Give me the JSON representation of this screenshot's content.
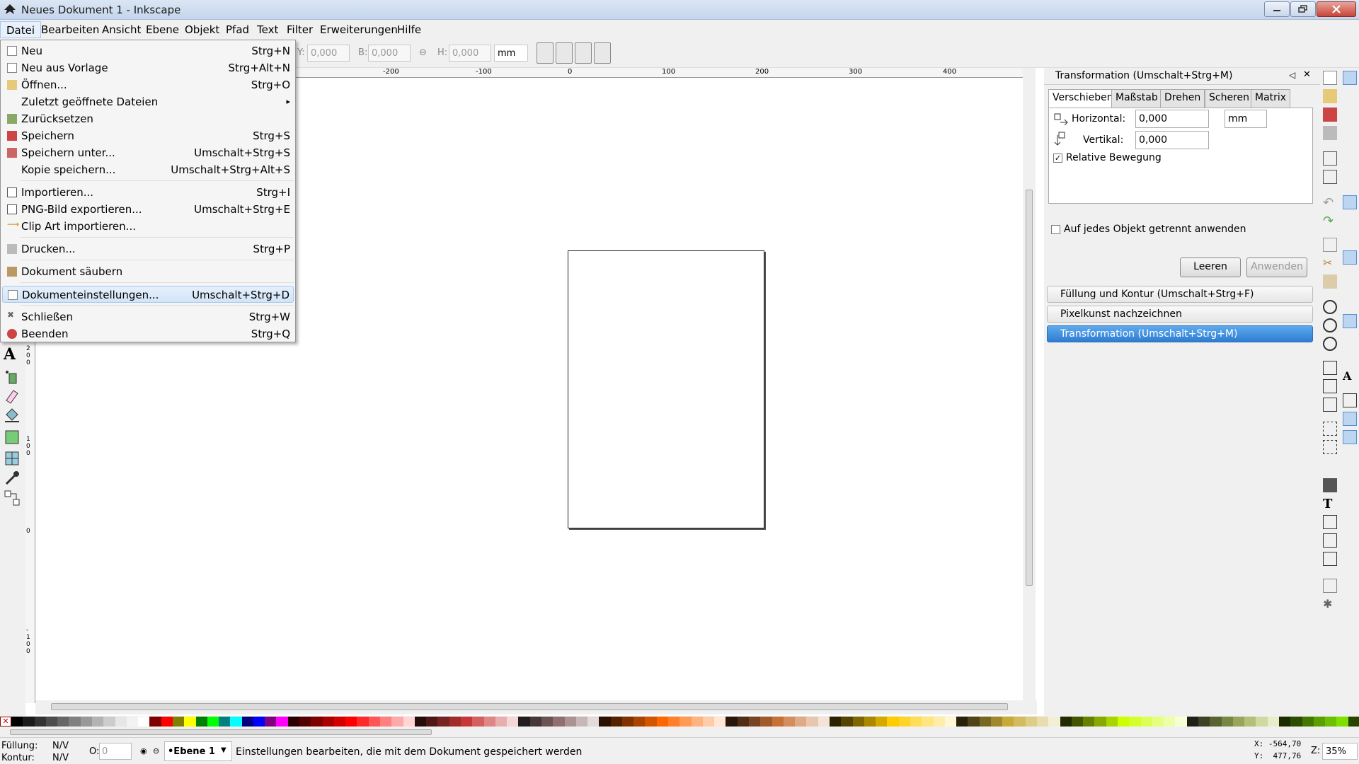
{
  "window": {
    "title": "Neues Dokument 1 - Inkscape"
  },
  "menubar": [
    "Datei",
    "Bearbeiten",
    "Ansicht",
    "Ebene",
    "Objekt",
    "Pfad",
    "Text",
    "Filter",
    "Erweiterungen",
    "Hilfe"
  ],
  "toolcontrols": {
    "y_label": "Y:",
    "y_value": "0,000",
    "b_label": "B:",
    "b_value": "0,000",
    "h_label": "H:",
    "h_value": "0,000",
    "unit": "mm"
  },
  "ruler": {
    "ticks": [
      "-200",
      "-100",
      "0",
      "100",
      "200",
      "300",
      "400"
    ],
    "vticks": [
      "2\n0\n0",
      "1\n0\n0",
      "0",
      "-\n1\n0\n0"
    ]
  },
  "file_menu": {
    "items": [
      {
        "label": "Neu",
        "shortcut": "Strg+N",
        "icon": "new-document-icon"
      },
      {
        "label": "Neu aus Vorlage",
        "shortcut": "Strg+Alt+N",
        "icon": "template-icon"
      },
      {
        "label": "Öffnen...",
        "shortcut": "Strg+O",
        "icon": "open-folder-icon"
      },
      {
        "label": "Zuletzt geöffnete Dateien",
        "shortcut": "",
        "icon": "submenu-arrow-icon"
      },
      {
        "label": "Zurücksetzen",
        "shortcut": "",
        "icon": "revert-icon"
      },
      {
        "label": "Speichern",
        "shortcut": "Strg+S",
        "icon": "save-icon"
      },
      {
        "label": "Speichern unter...",
        "shortcut": "Umschalt+Strg+S",
        "icon": "save-as-icon"
      },
      {
        "label": "Kopie speichern...",
        "shortcut": "Umschalt+Strg+Alt+S",
        "icon": ""
      },
      {
        "label": "Importieren...",
        "shortcut": "Strg+I",
        "icon": "import-icon"
      },
      {
        "label": "PNG-Bild exportieren...",
        "shortcut": "Umschalt+Strg+E",
        "icon": "export-icon"
      },
      {
        "label": "Clip Art importieren...",
        "shortcut": "",
        "icon": "clipart-icon"
      },
      {
        "label": "Drucken...",
        "shortcut": "Strg+P",
        "icon": "print-icon"
      },
      {
        "label": "Dokument säubern",
        "shortcut": "",
        "icon": "vacuum-icon"
      },
      {
        "label": "Dokumenteinstellungen...",
        "shortcut": "Umschalt+Strg+D",
        "icon": "document-properties-icon"
      },
      {
        "label": "Schließen",
        "shortcut": "Strg+W",
        "icon": "close-icon"
      },
      {
        "label": "Beenden",
        "shortcut": "Strg+Q",
        "icon": "quit-icon"
      }
    ]
  },
  "dock": {
    "title": "Transformation (Umschalt+Strg+M)",
    "tabs": [
      "Verschieben",
      "Maßstab",
      "Drehen",
      "Scheren",
      "Matrix"
    ],
    "horizontal_label": "Horizontal:",
    "horizontal_value": "0,000",
    "vertical_label": "Vertikal:",
    "vertical_value": "0,000",
    "unit": "mm",
    "relative_label": "Relative Bewegung",
    "separately_label": "Auf jedes Objekt getrennt anwenden",
    "clear_label": "Leeren",
    "apply_label": "Anwenden",
    "panels": [
      "Füllung und Kontur (Umschalt+Strg+F)",
      "Pixelkunst nachzeichnen",
      "Transformation (Umschalt+Strg+M)"
    ]
  },
  "status": {
    "fill_label": "Füllung:",
    "fill_value": "N/V",
    "stroke_label": "Kontur:",
    "stroke_value": "N/V",
    "opacity_label": "O:",
    "opacity_value": "0",
    "layer": "•Ebene 1",
    "message": "Einstellungen bearbeiten, die mit dem Dokument gespeichert werden",
    "x_coord": "X: -564,70",
    "y_coord": "Y:  477,76",
    "zoom_label": "Z:",
    "zoom": "35%"
  },
  "palette_colors": [
    "#000000",
    "#1a1a1a",
    "#333333",
    "#4d4d4d",
    "#666666",
    "#808080",
    "#999999",
    "#b3b3b3",
    "#cccccc",
    "#e6e6e6",
    "#f2f2f2",
    "#ffffff",
    "#800000",
    "#ff0000",
    "#808000",
    "#ffff00",
    "#008000",
    "#00ff00",
    "#008080",
    "#00ffff",
    "#000080",
    "#0000ff",
    "#800080",
    "#ff00ff",
    "#2b0000",
    "#550000",
    "#800000",
    "#aa0000",
    "#d40000",
    "#ff0000",
    "#ff2a2a",
    "#ff5555",
    "#ff8080",
    "#ffaaaa",
    "#ffd5d5",
    "#280b0b",
    "#501616",
    "#782121",
    "#a02c2c",
    "#c83737",
    "#d35f5f",
    "#de8787",
    "#e9afaf",
    "#f4d7d7",
    "#241c1c",
    "#483737",
    "#6c5353",
    "#916f6f",
    "#ac9393",
    "#c8b7b7",
    "#e3dbdb",
    "#2b1100",
    "#552200",
    "#803300",
    "#aa4400",
    "#d45500",
    "#ff6600",
    "#ff7f2a",
    "#ff9955",
    "#ffb380",
    "#ffccaa",
    "#ffe6d5",
    "#28170b",
    "#502d16",
    "#784421",
    "#a05a2c",
    "#c87137",
    "#d38d5f",
    "#deaa87",
    "#e9c6af",
    "#f4e3d7",
    "#2b2200",
    "#554400",
    "#806600",
    "#aa8800",
    "#d4aa00",
    "#ffcc00",
    "#ffd42a",
    "#ffdd55",
    "#ffe680",
    "#ffeeaa",
    "#fff6d5",
    "#28220b",
    "#504416",
    "#786721",
    "#a0892c",
    "#c8ab37",
    "#d3bc5f",
    "#decd87",
    "#e9ddaf",
    "#f4eed7",
    "#222b00",
    "#445500",
    "#668000",
    "#88aa00",
    "#aad400",
    "#ccff00",
    "#d4ff2a",
    "#ddff55",
    "#e5ff80",
    "#eeffaa",
    "#f6ffd5",
    "#1e2116",
    "#3c4224",
    "#5a6332",
    "#778843",
    "#99a55a",
    "#b6bf7a",
    "#d1d9a1",
    "#e9ecc8",
    "#1c2b00",
    "#2d4d00",
    "#447800",
    "#5aa000",
    "#6cc000",
    "#7fe000",
    "#2a4400"
  ]
}
